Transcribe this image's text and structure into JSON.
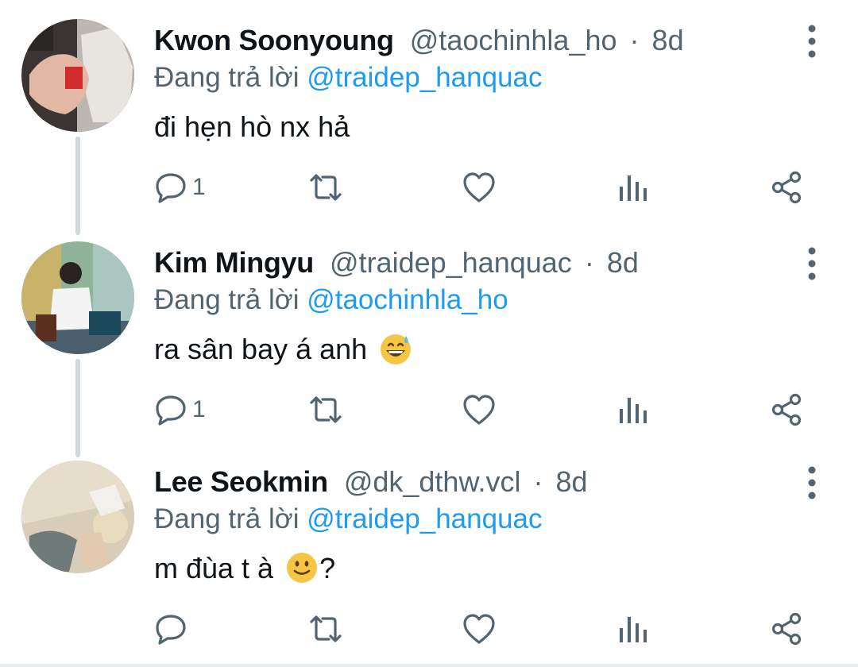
{
  "colors": {
    "text_primary": "#0f1419",
    "text_secondary": "#536471",
    "mention": "#1d9bf0",
    "thread_line": "#cfd9de"
  },
  "tweets": [
    {
      "name": "Kwon Soonyoung",
      "handle": "@taochinhla_ho",
      "separator": "·",
      "time": "8d",
      "replying_prefix": "Đang trả lời",
      "replying_to": "@traidep_hanquac",
      "text": "đi hẹn hò nx hả",
      "emoji": "",
      "text_suffix": "",
      "reply_count": "1",
      "icons": [
        "reply-icon",
        "retweet-icon",
        "like-icon",
        "views-icon",
        "share-icon",
        "more-icon"
      ]
    },
    {
      "name": "Kim Mingyu",
      "handle": "@traidep_hanquac",
      "separator": "·",
      "time": "8d",
      "replying_prefix": "Đang trả lời",
      "replying_to": "@taochinhla_ho",
      "text": "ra sân bay á anh",
      "emoji": "grinning-sweat-emoji",
      "text_suffix": "",
      "reply_count": "1",
      "icons": [
        "reply-icon",
        "retweet-icon",
        "like-icon",
        "views-icon",
        "share-icon",
        "more-icon"
      ]
    },
    {
      "name": "Lee Seokmin",
      "handle": "@dk_dthw.vcl",
      "separator": "·",
      "time": "8d",
      "replying_prefix": "Đang trả lời",
      "replying_to": "@traidep_hanquac",
      "text": "m đùa t à",
      "emoji": "slightly-smiling-emoji",
      "text_suffix": "?",
      "reply_count": "",
      "icons": [
        "reply-icon",
        "retweet-icon",
        "like-icon",
        "views-icon",
        "share-icon",
        "more-icon"
      ]
    }
  ]
}
